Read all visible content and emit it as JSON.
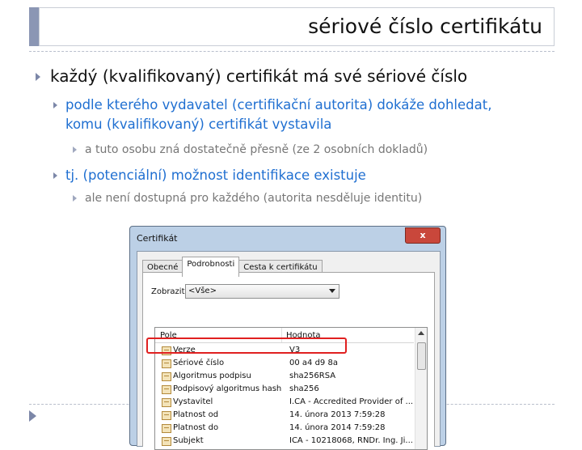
{
  "slide": {
    "title": "sériové číslo certifikátu",
    "bullets": {
      "b1": "každý (kvalifikovaný) certifikát má své sériové číslo",
      "b2a": "podle kterého vydavatel (certifikační autorita) dokáže dohledat, komu (kvalifikovaný) certifikát vystavila",
      "b3a": "a tuto osobu zná dostatečně přesně (ze 2 osobních dokladů)",
      "b2b": "tj. (potenciální) možnost identifikace existuje",
      "b3b": "ale není dostupná pro každého (autorita nesděluje identitu)"
    }
  },
  "dialog": {
    "title": "Certifikát",
    "close_label": "x",
    "tabs": [
      "Obecné",
      "Podrobnosti",
      "Cesta k certifikátu"
    ],
    "show_label": "Zobrazit:",
    "show_value": "<Vše>",
    "columns": [
      "Pole",
      "Hodnota"
    ],
    "rows": [
      {
        "field": "Verze",
        "value": "V3"
      },
      {
        "field": "Sériové číslo",
        "value": "00 a4 d9 8a"
      },
      {
        "field": "Algoritmus podpisu",
        "value": "sha256RSA"
      },
      {
        "field": "Podpisový algoritmus hash",
        "value": "sha256"
      },
      {
        "field": "Vystavitel",
        "value": "I.CA - Accredited Provider of ..."
      },
      {
        "field": "Platnost od",
        "value": "14. února 2013 7:59:28"
      },
      {
        "field": "Platnost do",
        "value": "14. února 2014 7:59:28"
      },
      {
        "field": "Subjekt",
        "value": "ICA - 10218068, RNDr. Ing. Ji..."
      }
    ]
  },
  "colors": {
    "accent": "#8b96b4",
    "level2_text": "#1f6fd1",
    "highlight": "#e02020"
  }
}
